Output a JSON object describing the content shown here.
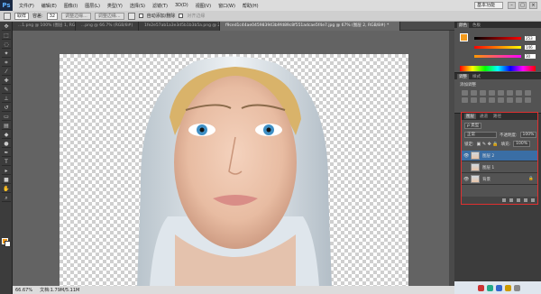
{
  "menubar": {
    "logo": "Ps",
    "items": [
      "文件(F)",
      "编辑(E)",
      "图像(I)",
      "图层(L)",
      "类型(Y)",
      "选择(S)",
      "滤镜(T)",
      "3D(D)",
      "视图(V)",
      "窗口(W)",
      "帮助(H)"
    ],
    "workspace": "基本功能"
  },
  "options": {
    "sample": "取样",
    "tolerance_label": "容差:",
    "tolerance_value": "32",
    "btn1": "调整边缘...",
    "btn2": "调整边缘...",
    "auto_add": "自动添加/删除",
    "align": "对齐边缘"
  },
  "tabs": [
    {
      "label": "...1.png @ 100% (图层 1, RGB/8#)",
      "active": false
    },
    {
      "label": "...png @ 66.7% (RGB/8#)",
      "active": false
    },
    {
      "label": "1fe2e57ab1a3e3d5b1b3b5a.png @ 25%",
      "active": false
    },
    {
      "label": "f9ced1c44ae045983943b9fd89c8f551adcae5f4e7.jpg @ 67% (图层 2, RGB/8#) *",
      "active": true
    }
  ],
  "status": {
    "zoom": "66.67%",
    "doc": "文档:1.79M/5.11M"
  },
  "panels": {
    "color_tabs": [
      "颜色",
      "色板"
    ],
    "r_value": "253",
    "g_value": "146",
    "b_value": "30",
    "adjust_tabs": [
      "调整",
      "样式"
    ],
    "adjust_title": "添加调整",
    "layer_tabs": [
      "图层",
      "通道",
      "路径"
    ],
    "filter_kind": "ρ 类型",
    "blend_mode": "正常",
    "opacity_label": "不透明度:",
    "opacity_value": "100%",
    "lock_label": "锁定:",
    "fill_label": "填充:",
    "fill_value": "100%",
    "layers": [
      {
        "name": "图层 2",
        "visible": true,
        "selected": true
      },
      {
        "name": "图层 1",
        "visible": false,
        "selected": false
      },
      {
        "name": "背景",
        "visible": true,
        "selected": false
      }
    ]
  },
  "accent_colors": {
    "selection": "#3a6ea5",
    "highlight": "#e03030",
    "foreground": "#f39a1c"
  }
}
